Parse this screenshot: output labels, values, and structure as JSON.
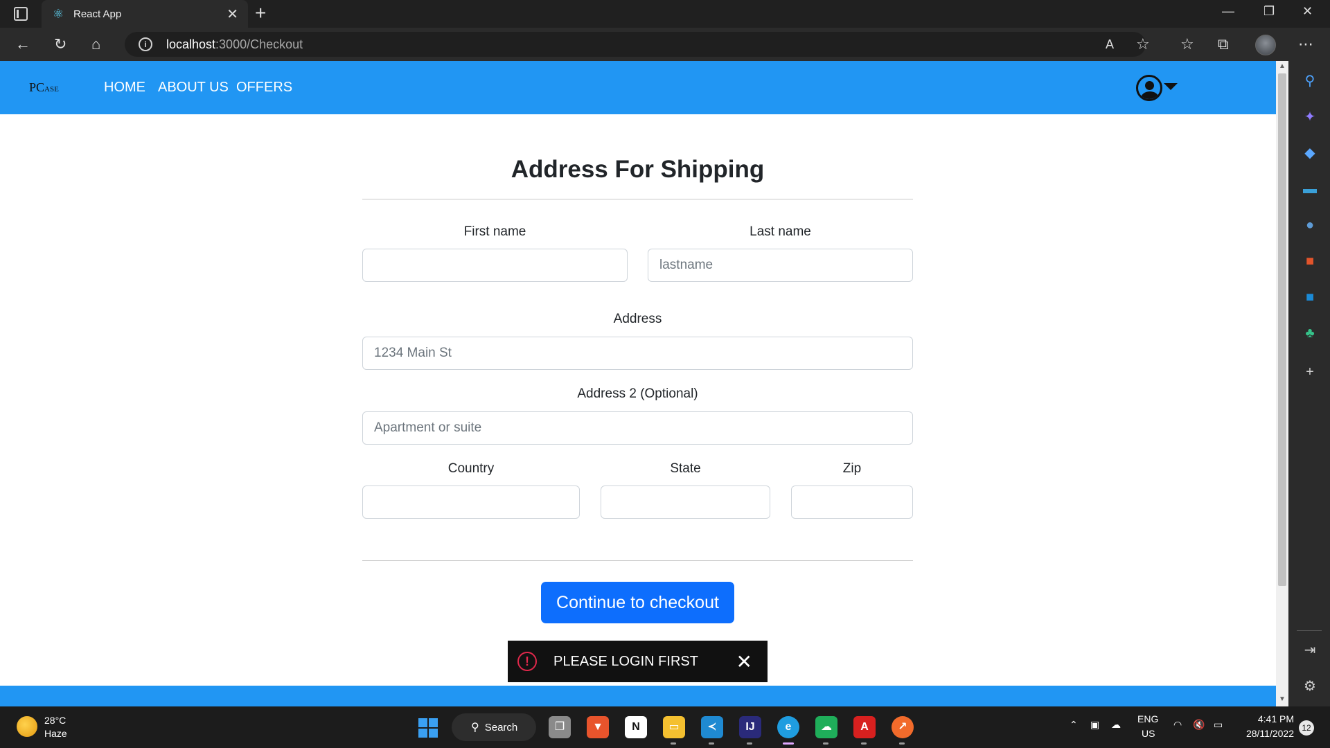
{
  "browser": {
    "tab_title": "React App",
    "url_host": "localhost",
    "url_path": ":3000/Checkout"
  },
  "navbar": {
    "brand_main": "PC",
    "brand_small": "ASE",
    "links": [
      "HOME",
      "ABOUT US",
      "OFFERS"
    ],
    "color": "#2196f3"
  },
  "form": {
    "title": "Address For Shipping",
    "first_name": {
      "label": "First name",
      "placeholder": "",
      "value": ""
    },
    "last_name": {
      "label": "Last name",
      "placeholder": "lastname",
      "value": ""
    },
    "address": {
      "label": "Address",
      "placeholder": "1234 Main St",
      "value": ""
    },
    "address2": {
      "label": "Address 2 (Optional)",
      "placeholder": "Apartment or suite",
      "value": ""
    },
    "country": {
      "label": "Country",
      "value": ""
    },
    "state": {
      "label": "State",
      "value": ""
    },
    "zip": {
      "label": "Zip",
      "value": ""
    },
    "submit_label": "Continue to checkout",
    "submit_color": "#0d6efd"
  },
  "toast": {
    "message": "PLEASE LOGIN FIRST",
    "icon": "alert-circle-icon",
    "icon_color": "#e0284b"
  },
  "taskbar": {
    "weather_temp": "28°C",
    "weather_desc": "Haze",
    "search_label": "Search",
    "lang_top": "ENG",
    "lang_bottom": "US",
    "time": "4:41 PM",
    "date": "28/11/2022",
    "notification_count": "12"
  }
}
